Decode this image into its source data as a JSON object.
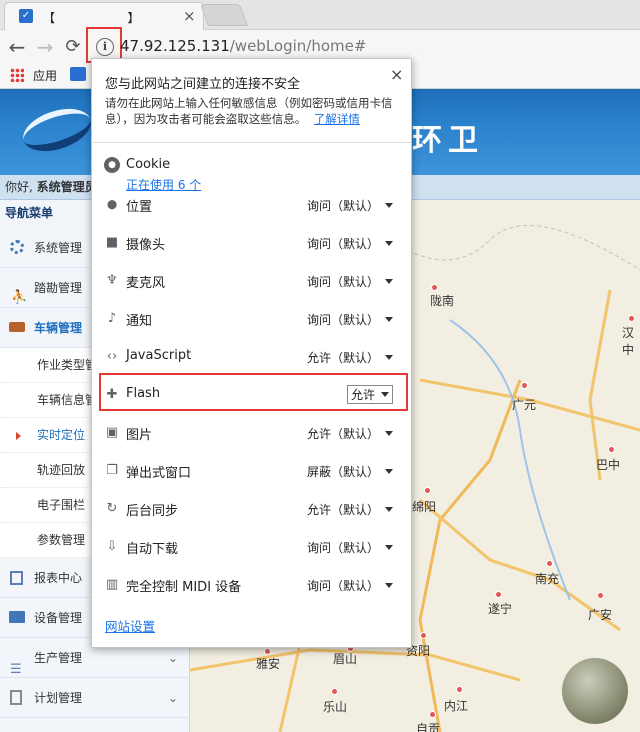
{
  "tab": {
    "title": "【                   】",
    "close": "×"
  },
  "address": {
    "url_host": "47.92.125.131",
    "url_path": "/webLogin/home#"
  },
  "bookmarks": {
    "apps_label": "应用"
  },
  "page": {
    "banner_title": "环卫",
    "greeting_prefix": "你好,",
    "greeting_user": "系统管理员",
    "nav_title": "导航菜单",
    "sidebar": {
      "items": [
        {
          "label": "系统管理"
        },
        {
          "label": "踏勘管理"
        },
        {
          "label": "车辆管理"
        }
      ],
      "subitems": [
        {
          "label": "作业类型管"
        },
        {
          "label": "车辆信息管"
        },
        {
          "label": "实时定位"
        },
        {
          "label": "轨迹回放"
        },
        {
          "label": "电子围栏"
        },
        {
          "label": "参数管理"
        }
      ],
      "items_bottom": [
        {
          "label": "报表中心"
        },
        {
          "label": "设备管理"
        },
        {
          "label": "生产管理"
        },
        {
          "label": "计划管理"
        }
      ]
    },
    "map_cities": [
      "陇南",
      "汉中",
      "广元",
      "巴中",
      "绵阳",
      "南充",
      "遂宁",
      "广安",
      "雅安",
      "眉山",
      "资阳",
      "乐山",
      "内江",
      "自贡"
    ]
  },
  "popup": {
    "title": "您与此网站之间建立的连接不安全",
    "desc": "请勿在此网站上输入任何敏感信息（例如密码或信用卡信息），因为攻击者可能会盗取这些信息。",
    "learn_more": "了解详情",
    "close": "×",
    "cookie_label": "Cookie",
    "cookie_usage": "正在使用 6 个",
    "permissions": [
      {
        "icon": "location-icon",
        "label": "位置",
        "value": "询问（默认）"
      },
      {
        "icon": "camera-icon",
        "label": "摄像头",
        "value": "询问（默认）"
      },
      {
        "icon": "microphone-icon",
        "label": "麦克风",
        "value": "询问（默认）"
      },
      {
        "icon": "bell-icon",
        "label": "通知",
        "value": "询问（默认）"
      },
      {
        "icon": "code-icon",
        "label": "JavaScript",
        "value": "允许（默认）"
      },
      {
        "icon": "puzzle-icon",
        "label": "Flash",
        "value": "允许"
      },
      {
        "icon": "image-icon",
        "label": "图片",
        "value": "允许（默认）"
      },
      {
        "icon": "popup-icon",
        "label": "弹出式窗口",
        "value": "屏蔽（默认）"
      },
      {
        "icon": "sync-icon",
        "label": "后台同步",
        "value": "允许（默认）"
      },
      {
        "icon": "download-icon",
        "label": "自动下载",
        "value": "询问（默认）"
      },
      {
        "icon": "midi-icon",
        "label": "完全控制 MIDI 设备",
        "value": "询问（默认）"
      }
    ],
    "site_settings": "网站设置"
  },
  "colors": {
    "accent_red": "#e53935",
    "link_blue": "#1a73e8",
    "sidebar_active": "#1f6fbf"
  }
}
